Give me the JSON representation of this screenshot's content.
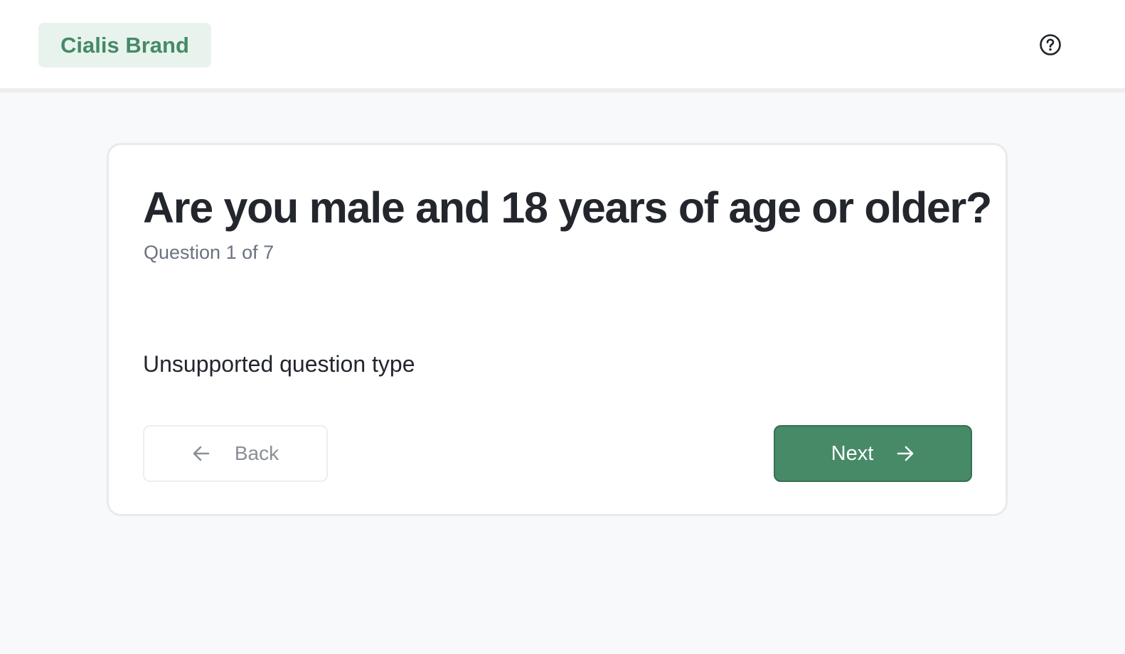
{
  "header": {
    "brand": "Cialis Brand",
    "help_icon": "help-circle-icon"
  },
  "question": {
    "title": "Are you male and 18 years of age or older?",
    "progress": "Question 1 of 7",
    "current": 1,
    "total": 7,
    "body_message": "Unsupported question type"
  },
  "navigation": {
    "back_label": "Back",
    "back_icon": "arrow-left-icon",
    "next_label": "Next",
    "next_icon": "arrow-right-icon"
  },
  "colors": {
    "brand_green": "#478a68",
    "brand_chip_bg": "#e9f3ed",
    "page_bg": "#f8f9fa"
  }
}
